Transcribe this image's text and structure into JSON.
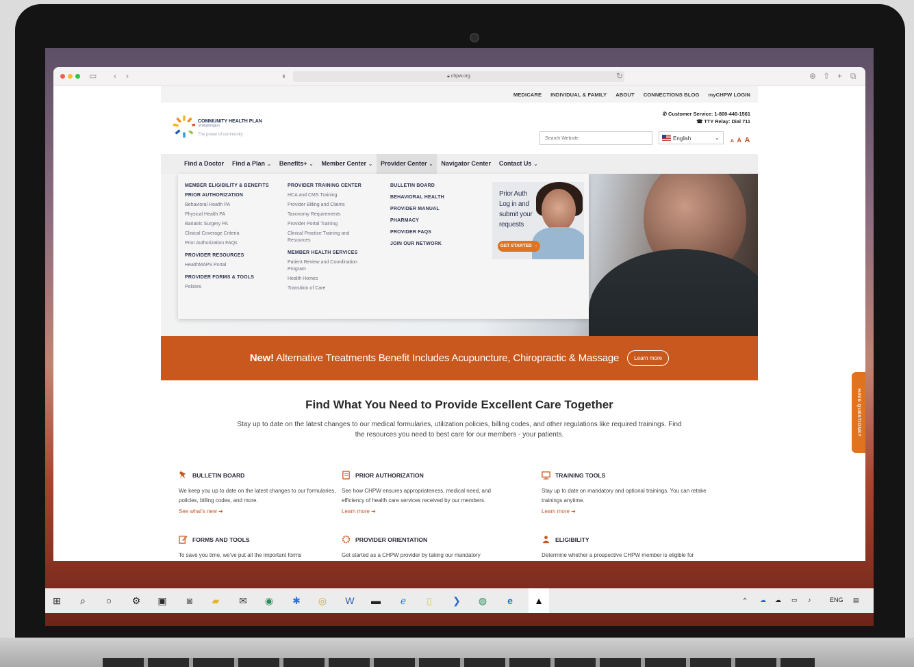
{
  "browser": {
    "url": "chpw.org"
  },
  "site": {
    "topbar": [
      "MEDICARE",
      "INDIVIDUAL & FAMILY",
      "ABOUT",
      "CONNECTIONS BLOG",
      "myCHPW LOGIN"
    ],
    "brand": {
      "name": "COMMUNITY HEALTH PLAN",
      "sub": "of Washington",
      "tagline": "The power of community"
    },
    "contact": {
      "customer_service": "Customer Service: 1-800-440-1561",
      "tty": "TTY Relay: Dial 711"
    },
    "search_placeholder": "Search Website",
    "language": "English",
    "font_sizes": [
      "A",
      "A",
      "A"
    ],
    "nav": [
      {
        "label": "Find a Doctor",
        "dropdown": false
      },
      {
        "label": "Find a Plan",
        "dropdown": true
      },
      {
        "label": "Benefits+",
        "dropdown": true
      },
      {
        "label": "Member Center",
        "dropdown": true
      },
      {
        "label": "Provider Center",
        "dropdown": true,
        "active": true
      },
      {
        "label": "Navigator Center",
        "dropdown": false
      },
      {
        "label": "Contact Us",
        "dropdown": true
      }
    ],
    "dropdown": {
      "col1": {
        "member_eligibility": "MEMBER ELIGIBILITY & BENEFITS",
        "prior_auth": "PRIOR AUTHORIZATION",
        "prior_auth_links": [
          "Behavioral Health PA",
          "Physical Health PA",
          "Bariatric Surgery PA",
          "Clinical Coverage Criteria",
          "Prior Authorization FAQs"
        ],
        "provider_resources": "PROVIDER RESOURCES",
        "provider_resources_links": [
          "HealthMAPS Portal"
        ],
        "forms_tools": "PROVIDER FORMS & TOOLS",
        "forms_tools_links": [
          "Policies"
        ]
      },
      "col2": {
        "training_center": "PROVIDER TRAINING CENTER",
        "training_links": [
          "HCA and CMS Training",
          "Provider Billing and Claims",
          "Taxonomy Requirements",
          "Provider Portal Training",
          "Clinical Practice Training and",
          "Resources"
        ],
        "member_services": "MEMBER HEALTH SERVICES",
        "member_services_links": [
          "Patient Review and Coordination",
          "Program",
          "Health Homes",
          "Transition of Care"
        ]
      },
      "col3": [
        "BULLETIN BOARD",
        "BEHAVIORAL HEALTH",
        "PROVIDER MANUAL",
        "PHARMACY",
        "PROVIDER FAQS",
        "JOIN OUR NETWORK"
      ],
      "promo": {
        "line1": "Prior Auth",
        "line2": "Log in and",
        "line3": "submit your",
        "line4": "requests",
        "button": "GET STARTED →"
      }
    },
    "banner": {
      "new": "New!",
      "text": " Alternative Treatments Benefit Includes Acupuncture, Chiropractic & Massage",
      "button": "Learn more"
    },
    "main": {
      "title": "Find What You Need to Provide Excellent Care Together",
      "subtitle": "Stay up to date on the latest changes to our medical formularies, utilization policies, billing codes, and other regulations like required trainings. Find the resources you need to best care for our members - your patients."
    },
    "cards": [
      {
        "title": "BULLETIN BOARD",
        "text": "We keep you up to date on the latest changes to our formularies, policies, billing codes, and more.",
        "link": "See what's new ➜",
        "icon": "pushpin-icon"
      },
      {
        "title": "PRIOR AUTHORIZATION",
        "text": "See how CHPW ensures appropriateness, medical need, and efficiency of health care services received by our members.",
        "link": "Learn more ➜",
        "icon": "document-icon"
      },
      {
        "title": "TRAINING TOOLS",
        "text": "Stay up to date on mandatory and optional trainings. You can retake trainings anytime.",
        "link": "Learn more ➜",
        "icon": "presentation-icon"
      },
      {
        "title": "FORMS AND TOOLS",
        "text": "To save you time, we've put all the important forms",
        "icon": "form-edit-icon"
      },
      {
        "title": "PROVIDER ORIENTATION",
        "text": "Get started as a CHPW provider by taking our mandatory",
        "icon": "chpw-logo-icon"
      },
      {
        "title": "ELIGIBILITY",
        "text": "Determine whether a prospective CHPW member is eligible for",
        "icon": "person-check-icon"
      }
    ],
    "side_tab": "HAVE QUESTIONS?"
  },
  "taskbar": {
    "tray_lang": "ENG"
  },
  "colors": {
    "accent_orange": "#c9581f",
    "button_orange": "#e0731f",
    "navy": "#2c3550"
  }
}
